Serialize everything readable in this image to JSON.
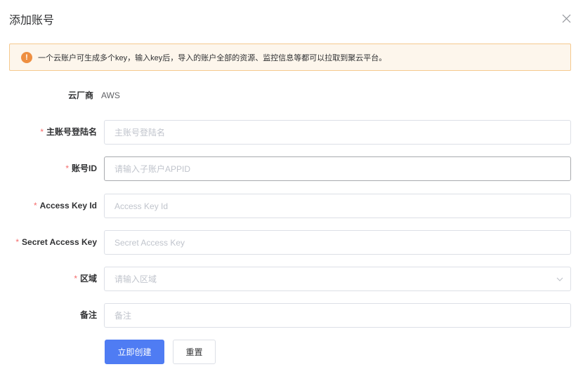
{
  "dialog": {
    "title": "添加账号",
    "close_icon": "close-icon"
  },
  "alert": {
    "icon": "warning-circle-icon",
    "icon_glyph": "!",
    "text": "一个云账户可生成多个key，输入key后，导入的账户全部的资源、监控信息等都可以拉取到聚云平台。"
  },
  "form": {
    "vendor": {
      "label": "云厂商",
      "value": "AWS"
    },
    "master_account": {
      "required_mark": "*",
      "label": "主账号登陆名",
      "value": "",
      "placeholder": "主账号登陆名"
    },
    "account_id": {
      "required_mark": "*",
      "label": "账号ID",
      "value": "",
      "placeholder": "请输入子账户APPID"
    },
    "access_key_id": {
      "required_mark": "*",
      "label": "Access Key Id",
      "value": "",
      "placeholder": "Access Key Id"
    },
    "secret_access_key": {
      "required_mark": "*",
      "label": "Secret Access Key",
      "value": "",
      "placeholder": "Secret Access Key"
    },
    "region": {
      "required_mark": "*",
      "label": "区域",
      "value": "",
      "placeholder": "请输入区域",
      "icon": "chevron-down-icon"
    },
    "remark": {
      "label": "备注",
      "value": "",
      "placeholder": "备注"
    }
  },
  "buttons": {
    "create_label": "立即创建",
    "reset_label": "重置"
  },
  "colors": {
    "primary": "#4f7cf3",
    "warning": "#ee8f41",
    "alert_bg": "#fdf6ec",
    "alert_border": "#f5c98e",
    "required": "#f56c6c"
  }
}
